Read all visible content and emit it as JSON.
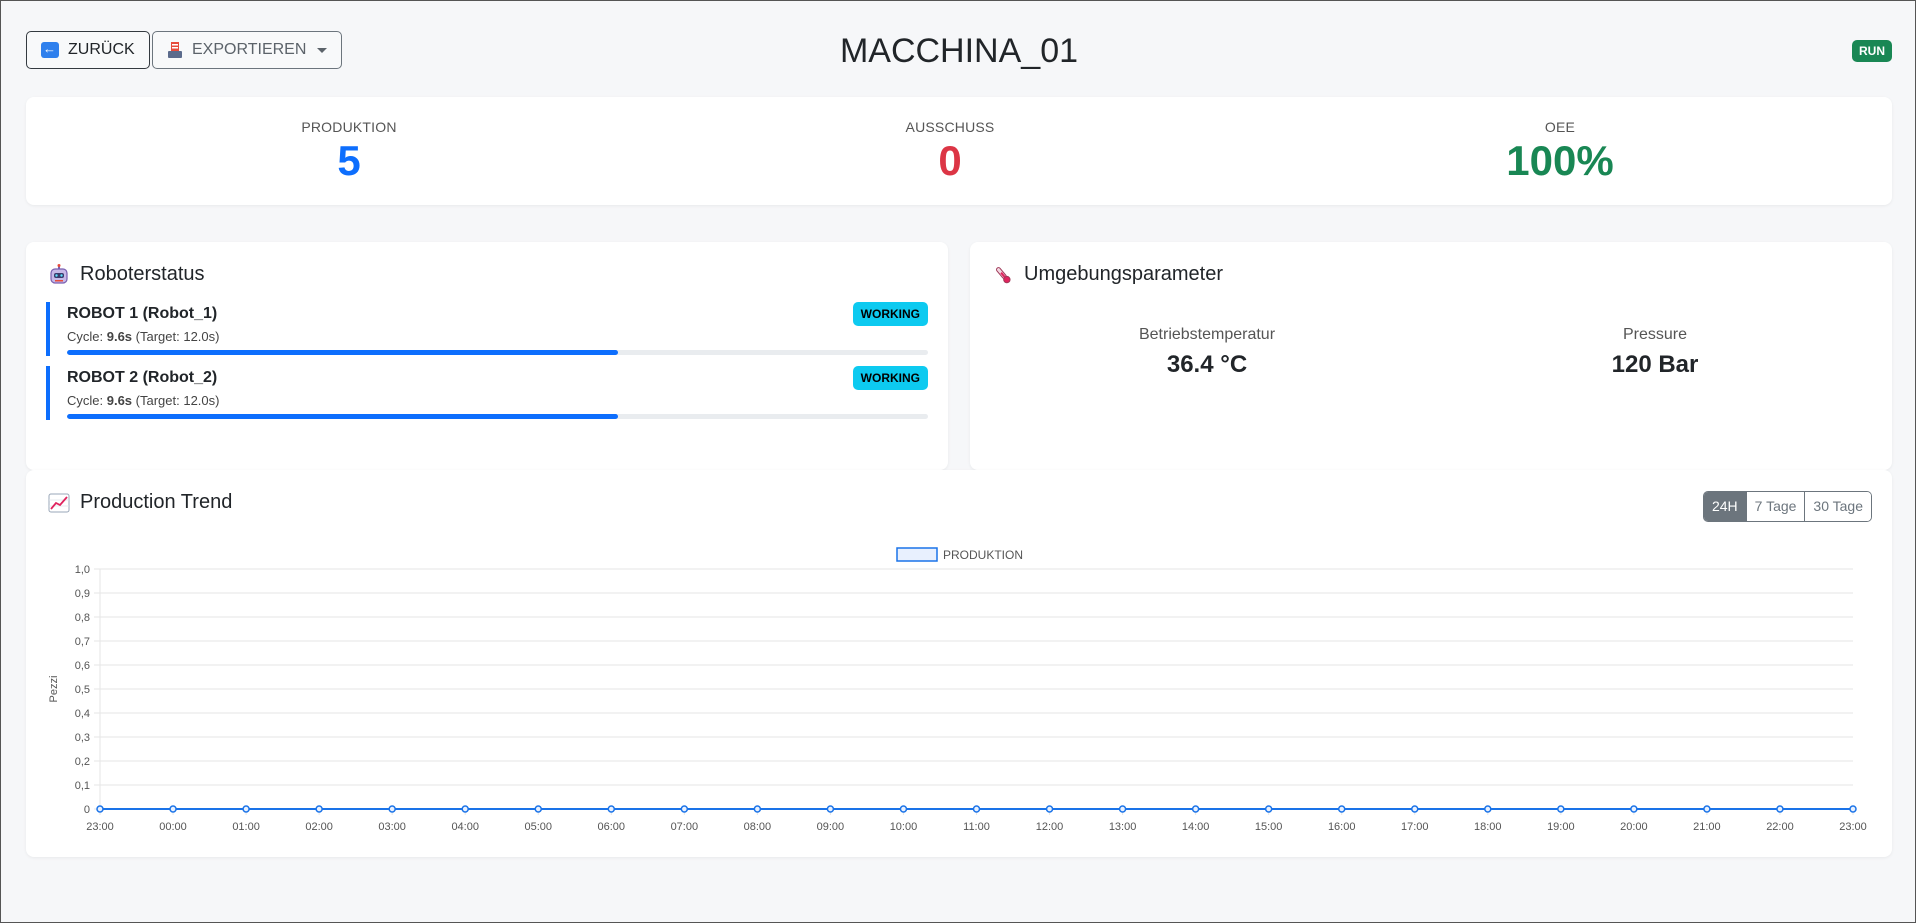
{
  "header": {
    "back_label": "ZURÜCK",
    "export_label": "EXPORTIEREN",
    "title": "MACCHINA_01",
    "status": "RUN"
  },
  "kpis": {
    "production": {
      "label": "PRODUKTION",
      "value": "5",
      "color": "#0d6efd"
    },
    "scrap": {
      "label": "AUSSCHUSS",
      "value": "0",
      "color": "#dc3545"
    },
    "oee": {
      "label": "OEE",
      "value": "100%",
      "color": "#198754"
    }
  },
  "robots": {
    "title": "Roboterstatus",
    "items": [
      {
        "name": "ROBOT 1 (Robot_1)",
        "cycle_prefix": "Cycle: ",
        "cycle_value": "9.6s",
        "cycle_target": " (Target: 12.0s)",
        "status": "WORKING",
        "progress": 0.64
      },
      {
        "name": "ROBOT 2 (Robot_2)",
        "cycle_prefix": "Cycle: ",
        "cycle_value": "9.6s",
        "cycle_target": " (Target: 12.0s)",
        "status": "WORKING",
        "progress": 0.64
      }
    ]
  },
  "environment": {
    "title": "Umgebungsparameter",
    "params": [
      {
        "label": "Betriebstemperatur",
        "value": "36.4 °C"
      },
      {
        "label": "Pressure",
        "value": "120 Bar"
      }
    ]
  },
  "trend": {
    "title": "Production Trend",
    "ranges": [
      "24H",
      "7 Tage",
      "30 Tage"
    ],
    "active_range": "24H"
  },
  "chart_data": {
    "type": "line",
    "title": "",
    "xlabel": "",
    "ylabel": "Pezzi",
    "x": [
      "23:00",
      "00:00",
      "01:00",
      "02:00",
      "03:00",
      "04:00",
      "05:00",
      "06:00",
      "07:00",
      "08:00",
      "09:00",
      "10:00",
      "11:00",
      "12:00",
      "13:00",
      "14:00",
      "15:00",
      "16:00",
      "17:00",
      "18:00",
      "19:00",
      "20:00",
      "21:00",
      "22:00",
      "23:00"
    ],
    "series": [
      {
        "name": "PRODUKTION",
        "color": "#1a73e8",
        "values": [
          0,
          0,
          0,
          0,
          0,
          0,
          0,
          0,
          0,
          0,
          0,
          0,
          0,
          0,
          0,
          0,
          0,
          0,
          0,
          0,
          0,
          0,
          0,
          0,
          0
        ]
      }
    ],
    "ylim": [
      0,
      1
    ],
    "yticks": [
      "0",
      "0,1",
      "0,2",
      "0,3",
      "0,4",
      "0,5",
      "0,6",
      "0,7",
      "0,8",
      "0,9",
      "1,0"
    ],
    "grid": true,
    "legend": "top-center"
  }
}
